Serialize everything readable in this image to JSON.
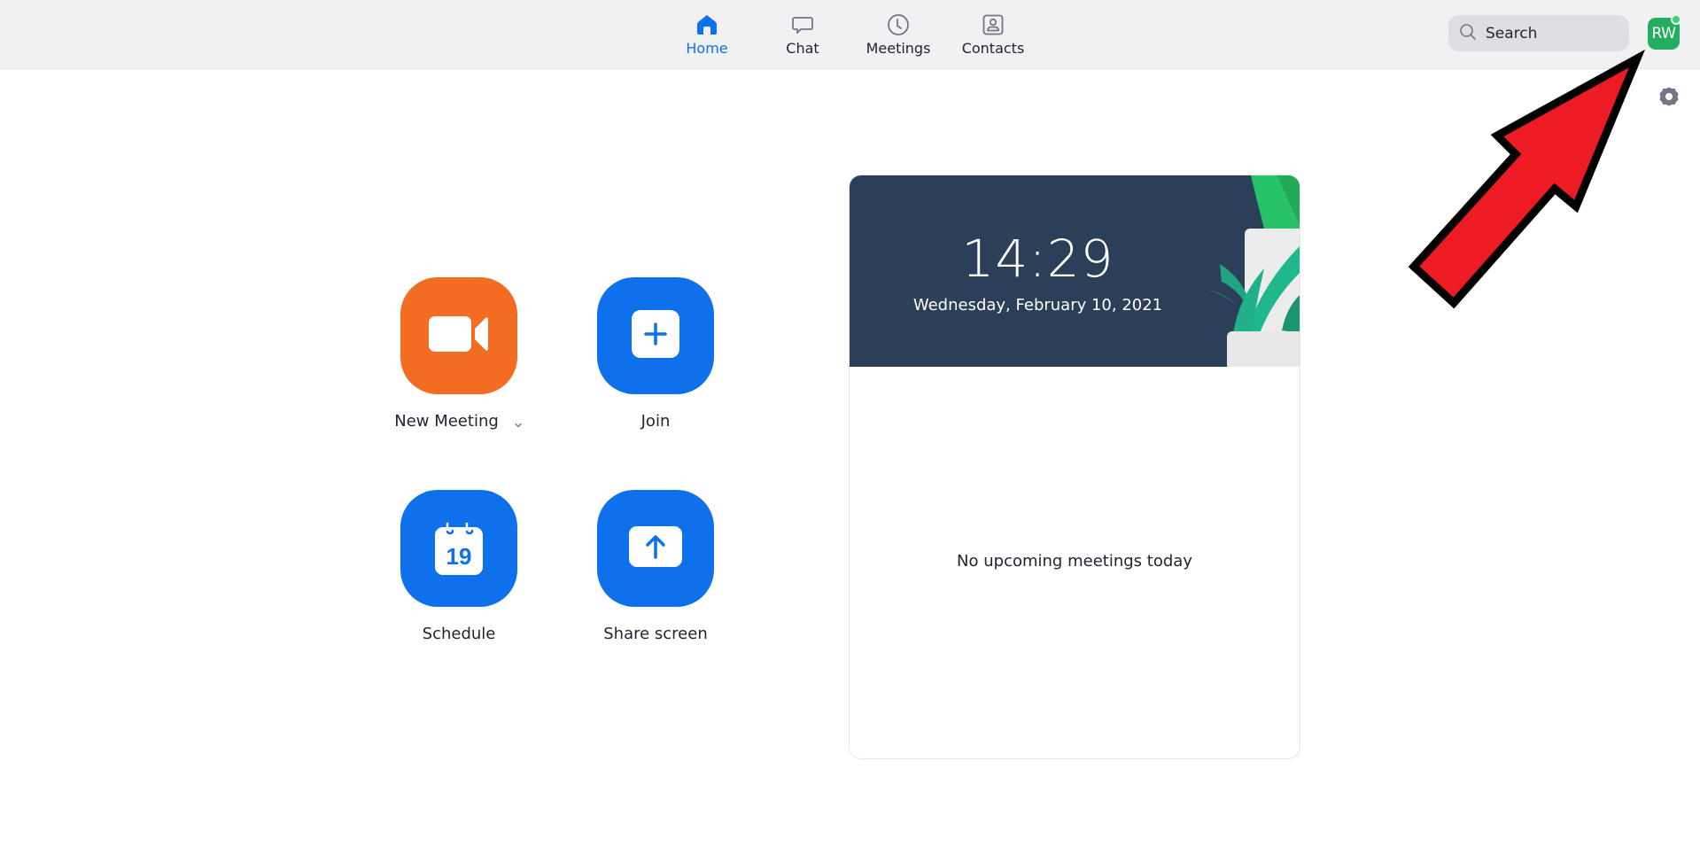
{
  "nav": {
    "items": [
      {
        "label": "Home",
        "icon": "home-icon",
        "active": true
      },
      {
        "label": "Chat",
        "icon": "chat-icon",
        "active": false
      },
      {
        "label": "Meetings",
        "icon": "clock-icon",
        "active": false
      },
      {
        "label": "Contacts",
        "icon": "contacts-icon",
        "active": false
      }
    ]
  },
  "search": {
    "placeholder": "Search"
  },
  "profile": {
    "initials": "RW",
    "status": "online",
    "color": "#25ad5f"
  },
  "actions": [
    {
      "label": "New Meeting",
      "icon": "video-camera-icon",
      "color": "#f26d21",
      "has_dropdown": true
    },
    {
      "label": "Join",
      "icon": "plus-icon",
      "color": "#0e71eb"
    },
    {
      "label": "Schedule",
      "icon": "calendar-icon",
      "color": "#0e71eb",
      "calendar_day": "19"
    },
    {
      "label": "Share screen",
      "icon": "share-up-arrow-icon",
      "color": "#0e71eb"
    }
  ],
  "clock_card": {
    "time": "14:29",
    "date": "Wednesday, February 10, 2021",
    "empty_message": "No upcoming meetings today"
  },
  "colors": {
    "accent": "#0e71eb",
    "orange": "#f26d21",
    "annotation_arrow": "#ed1c24"
  }
}
